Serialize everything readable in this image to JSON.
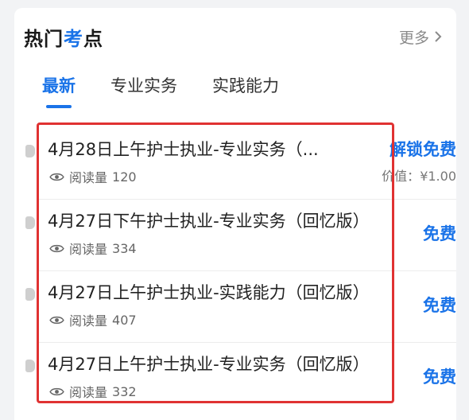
{
  "header": {
    "title_part1": "热门",
    "title_accent": "考",
    "title_part2": "点",
    "more_label": "更多"
  },
  "tabs": [
    {
      "label": "最新",
      "active": true
    },
    {
      "label": "专业实务",
      "active": false
    },
    {
      "label": "实践能力",
      "active": false
    }
  ],
  "items": [
    {
      "title": "4月28日上午护士执业-专业实务（...",
      "read_label": "阅读量",
      "read_count": "120",
      "action": "解锁免费",
      "price_label": "价值：",
      "price": "¥1.00"
    },
    {
      "title": "4月27日下午护士执业-专业实务（回忆版）",
      "read_label": "阅读量",
      "read_count": "334",
      "action": "免费"
    },
    {
      "title": "4月27日上午护士执业-实践能力（回忆版）",
      "read_label": "阅读量",
      "read_count": "407",
      "action": "免费"
    },
    {
      "title": "4月27日上午护士执业-专业实务（回忆版）",
      "read_label": "阅读量",
      "read_count": "332",
      "action": "免费"
    }
  ],
  "colors": {
    "accent": "#1a73e8",
    "highlight": "#e03232"
  },
  "icons": {
    "more": "chevron-right-icon",
    "read": "eye-icon",
    "bullet": "doc-bullet-icon"
  }
}
